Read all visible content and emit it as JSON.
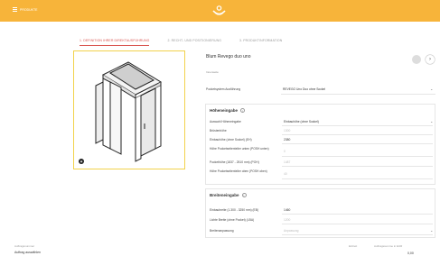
{
  "topbar": {
    "menu_label": "PRODUKTE"
  },
  "steps": [
    "1. DEFINITION IHRER DIREKTAUSFÜHRUNG",
    "2. RECHT- UND POSITIONIERUNG",
    "3. PRODUKTINFORMATION"
  ],
  "product": {
    "title": "Blum Revego duo uno",
    "note": "Innenseite"
  },
  "pocket": {
    "label": "Pocketsystem Ausführung",
    "value": "REVEGO Uno Duo ohne Sockel"
  },
  "hoehe": {
    "title": "Höheneingabe",
    "rows": [
      {
        "label": "Auswahl Höheneingabe",
        "value": "Einbauhöhe (ohne Sockel)",
        "select": true
      },
      {
        "label": "Brüstenhöhe",
        "value": "1300",
        "placeholder": true
      },
      {
        "label": "Einbauhöhe (ohne Sockel) (EH)",
        "value": "2380"
      },
      {
        "label": "Höhe Pocketseitenteiler unten (POSH unten)",
        "value": "0",
        "placeholder": true
      },
      {
        "label": "Pockethöhe (1837 - 2510 mm) (POH)",
        "value": "1487",
        "placeholder": true
      },
      {
        "label": "Höhe Pocketseitenteiler oben (POSH oben)",
        "value": "40",
        "placeholder": true
      }
    ]
  },
  "breite": {
    "title": "Breiteneingabe",
    "rows": [
      {
        "label": "Einbaubreite (1.300 - 3250 mm) (EB)",
        "value": "1460"
      },
      {
        "label": "Lichte Breite (ohne Pocket) (LBA)",
        "value": "1200",
        "placeholder": true
      },
      {
        "label": "Breitenanpassung",
        "value": "Anpassung",
        "select": true,
        "placeholder": true
      }
    ]
  },
  "footer": {
    "label": "Auftragsnummer",
    "action": "Auftrag auswählen",
    "right_label_1": "Einheit",
    "right_label_2": "Auftragssumme in EUR",
    "price": "0,00"
  },
  "colors": {
    "accent": "#f7b43a",
    "active_step": "#d9534f",
    "image_border": "#f2d24b"
  }
}
